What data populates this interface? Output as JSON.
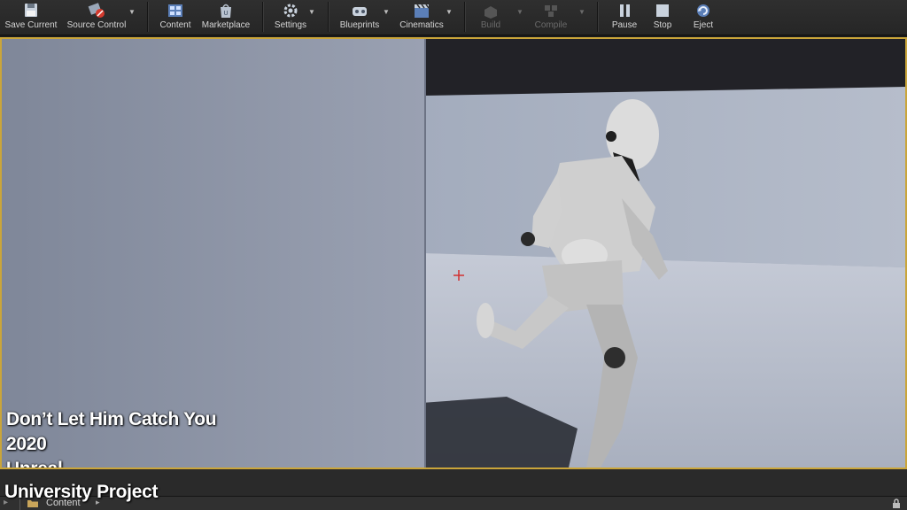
{
  "toolbar": {
    "items": [
      {
        "label": "Save Current",
        "icon": "save-icon"
      },
      {
        "label": "Source Control",
        "icon": "source-control-icon"
      },
      {
        "label": "Content",
        "icon": "content-icon"
      },
      {
        "label": "Marketplace",
        "icon": "marketplace-icon"
      },
      {
        "label": "Settings",
        "icon": "settings-icon"
      },
      {
        "label": "Blueprints",
        "icon": "blueprints-icon"
      },
      {
        "label": "Cinematics",
        "icon": "cinematics-icon"
      },
      {
        "label": "Build",
        "icon": "build-icon",
        "disabled": true
      },
      {
        "label": "Compile",
        "icon": "compile-icon",
        "disabled": true
      },
      {
        "label": "Pause",
        "icon": "pause-icon"
      },
      {
        "label": "Stop",
        "icon": "stop-icon"
      },
      {
        "label": "Eject",
        "icon": "eject-icon"
      }
    ]
  },
  "content_bar": {
    "label": "Content"
  },
  "overlay": {
    "title": "Don’t Let Him Catch You",
    "year": "2020",
    "engine": "Unreal",
    "type": "University Project"
  },
  "colors": {
    "viewport_border": "#caa53a",
    "crosshair": "#d23030"
  }
}
